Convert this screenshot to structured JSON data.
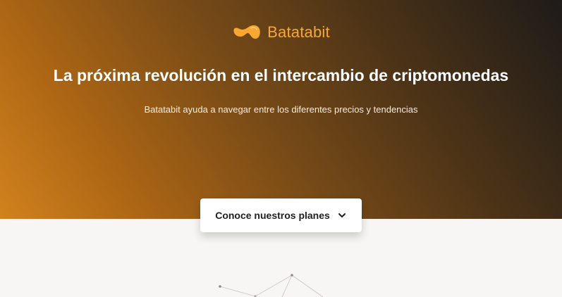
{
  "brand": {
    "name": "Batatabit",
    "logo_icon": "potato-logo-icon",
    "color": "#f8a732"
  },
  "hero": {
    "title": "La próxima revolución en el intercambio de criptomonedas",
    "subtitle": "Batatabit ayuda a navegar entre los diferentes precios y tendencias",
    "cta_label": "Conoce nuestros planes",
    "cta_icon": "chevron-down-icon"
  },
  "colors": {
    "hero_dark": "#1e1b19",
    "hero_orange": "#d1821d",
    "page_bg": "#f7f6f4"
  }
}
